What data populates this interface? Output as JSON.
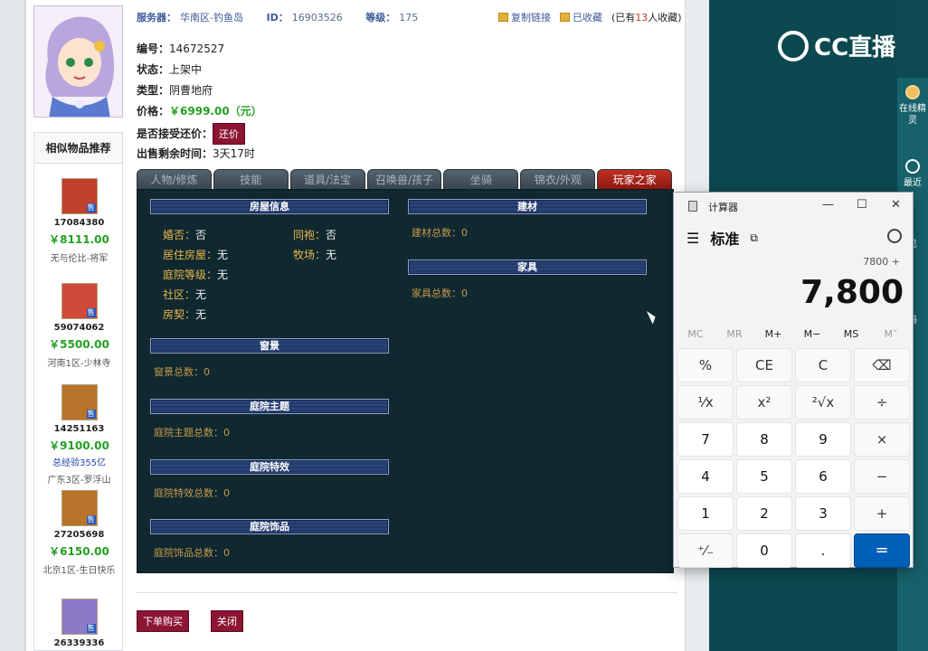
{
  "header": {
    "server_label": "服务器：",
    "server_value": "华南区-钓鱼岛",
    "id_label": "ID：",
    "id_value": "16903526",
    "level_label": "等级：",
    "level_value": "175",
    "copy_link": "复制链接",
    "favorited": "已收藏",
    "fav_prefix": "(已有",
    "fav_count": "13",
    "fav_suffix": "人收藏)"
  },
  "item": {
    "number_label": "编号：",
    "number_value": "14672527",
    "status_label": "状态：",
    "status_value": "上架中",
    "type_label": "类型：",
    "type_value": "阴曹地府",
    "price_label": "价格：",
    "price_value": "￥6999.00（元）",
    "counter_label": "是否接受还价：",
    "counter_button": "还价",
    "remain_label": "出售剩余时间：",
    "remain_value": "3天17时"
  },
  "recommend": {
    "title": "相似物品推荐",
    "items": [
      {
        "id": "17084380",
        "price": "￥8111.00",
        "exp": "",
        "server": "无与伦比-将军",
        "tag": "售",
        "color": "#c0402a"
      },
      {
        "id": "59074062",
        "price": "￥5500.00",
        "exp": "",
        "server": "河南1区-少林寺",
        "tag": "售",
        "color": "#d04a3a"
      },
      {
        "id": "14251163",
        "price": "￥9100.00",
        "exp": "总经验355亿",
        "server": "广东3区-罗浮山",
        "tag": "售",
        "color": "#b8742a"
      },
      {
        "id": "27205698",
        "price": "￥6150.00",
        "exp": "",
        "server": "北京1区-生日快乐",
        "tag": "售",
        "color": "#b8742a"
      },
      {
        "id": "26339336",
        "price": "",
        "exp": "",
        "server": "",
        "tag": "售",
        "color": "#8a7ac8"
      }
    ]
  },
  "tabs": [
    "人物/修炼",
    "技能",
    "道具/法宝",
    "召唤兽/孩子",
    "坐骑",
    "锦衣/外观",
    "玩家之家"
  ],
  "house": {
    "house_info_title": "房屋信息",
    "married_label": "婚否：",
    "married_value": "否",
    "cohabit_label": "同袍：",
    "cohabit_value": "否",
    "residence_label": "居住房屋：",
    "residence_value": "无",
    "ranch_label": "牧场：",
    "ranch_value": "无",
    "courtyard_level_label": "庭院等级：",
    "courtyard_level_value": "无",
    "community_label": "社区：",
    "community_value": "无",
    "deed_label": "房契：",
    "deed_value": "无",
    "window_title": "窗景",
    "window_total": "窗景总数：0",
    "theme_title": "庭院主题",
    "theme_total": "庭院主题总数：0",
    "effect_title": "庭院特效",
    "effect_total": "庭院特效总数：0",
    "ornament_title": "庭院饰品",
    "ornament_total": "庭院饰品总数：0",
    "material_title": "建材",
    "material_total": "建材总数：0",
    "furniture_title": "家具",
    "furniture_total": "家具总数：0"
  },
  "actions": {
    "buy": "下单购买",
    "close": "关闭"
  },
  "cc": {
    "logo": "CC直播",
    "side_online": "在线精灵",
    "side_recent": "最近",
    "side_chat": "见",
    "side_code": "码"
  },
  "calculator": {
    "title": "计算器",
    "mode": "标准",
    "expression": "7800 +",
    "display": "7,800",
    "memory": [
      "MC",
      "MR",
      "M+",
      "M−",
      "MS",
      "M˅"
    ],
    "keys": [
      "%",
      "CE",
      "C",
      "⌫",
      "¹⁄x",
      "x²",
      "²√x",
      "÷",
      "7",
      "8",
      "9",
      "×",
      "4",
      "5",
      "6",
      "−",
      "1",
      "2",
      "3",
      "+",
      "⁺⁄₋",
      "0",
      ".",
      "="
    ]
  }
}
